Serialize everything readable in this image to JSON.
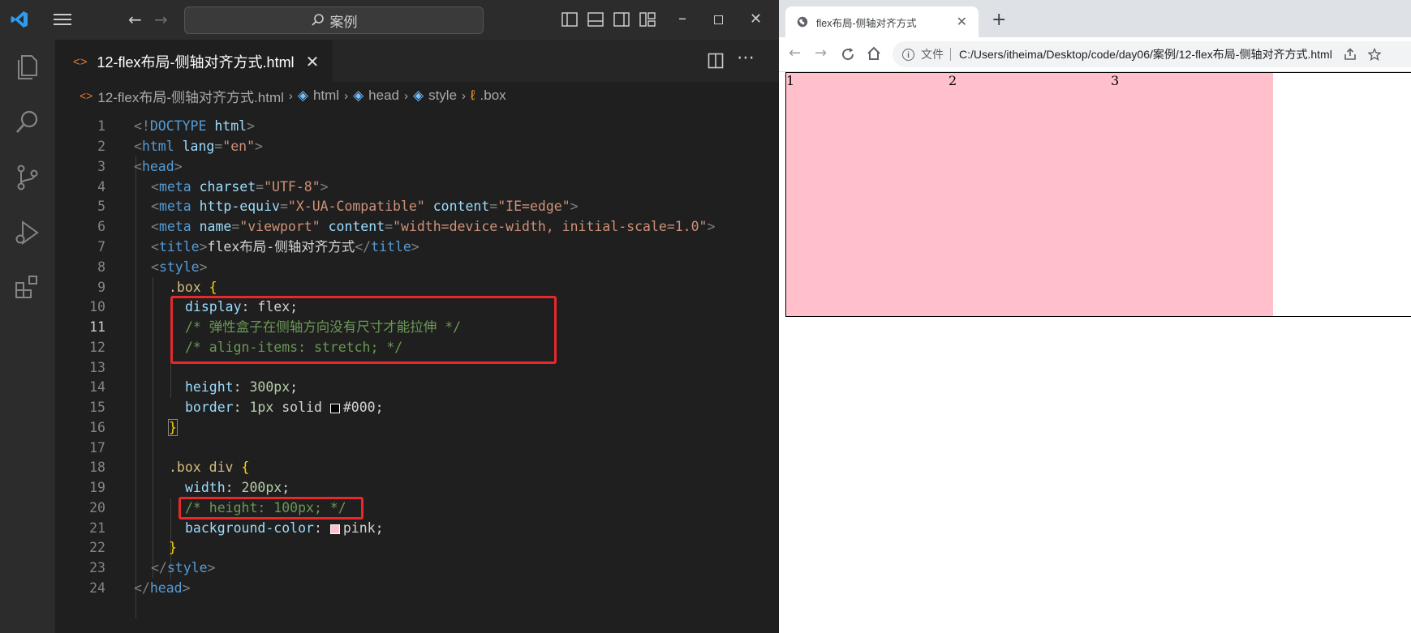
{
  "vscode": {
    "command_center": {
      "text": "案例"
    },
    "tab": {
      "label": "12-flex布局-侧轴对齐方式.html"
    },
    "breadcrumb": {
      "file": "12-flex布局-侧轴对齐方式.html",
      "items": [
        "html",
        "head",
        "style",
        ".box"
      ]
    },
    "code_lines": [
      {
        "n": "1"
      },
      {
        "n": "2"
      },
      {
        "n": "3"
      },
      {
        "n": "4"
      },
      {
        "n": "5"
      },
      {
        "n": "6"
      },
      {
        "n": "7"
      },
      {
        "n": "8"
      },
      {
        "n": "9"
      },
      {
        "n": "10"
      },
      {
        "n": "11"
      },
      {
        "n": "12"
      },
      {
        "n": "13"
      },
      {
        "n": "14"
      },
      {
        "n": "15"
      },
      {
        "n": "16"
      },
      {
        "n": "17"
      },
      {
        "n": "18"
      },
      {
        "n": "19"
      },
      {
        "n": "20"
      },
      {
        "n": "21"
      },
      {
        "n": "22"
      },
      {
        "n": "23"
      },
      {
        "n": "24"
      }
    ],
    "code": {
      "l1": {
        "a": "<!",
        "b": "DOCTYPE",
        "c": " html",
        "d": ">"
      },
      "l2": {
        "a": "<",
        "b": "html",
        "c": " lang",
        "d": "=",
        "e": "\"en\"",
        "f": ">"
      },
      "l3": {
        "a": "<",
        "b": "head",
        "c": ">"
      },
      "l4": {
        "a": "<",
        "b": "meta",
        "c": " charset",
        "d": "=",
        "e": "\"UTF-8\"",
        "f": ">"
      },
      "l5": {
        "a": "<",
        "b": "meta",
        "c": " http-equiv",
        "d": "=",
        "e": "\"X-UA-Compatible\"",
        "f": " content",
        "g": "=",
        "h": "\"IE=edge\"",
        "i": ">"
      },
      "l6": {
        "a": "<",
        "b": "meta",
        "c": " name",
        "d": "=",
        "e": "\"viewport\"",
        "f": " content",
        "g": "=",
        "h": "\"width=device-width, initial-scale=1.0\"",
        "i": ">"
      },
      "l7": {
        "a": "<",
        "b": "title",
        "c": ">",
        "d": "flex布局-侧轴对齐方式",
        "e": "</",
        "f": "title",
        "g": ">"
      },
      "l8": {
        "a": "<",
        "b": "style",
        "c": ">"
      },
      "l9": {
        "a": ".box",
        "b": " {"
      },
      "l10": {
        "a": "display",
        "b": ": ",
        "c": "flex",
        "d": ";"
      },
      "l11": {
        "a": "/* 弹性盒子在侧轴方向没有尺寸才能拉伸 */"
      },
      "l12": {
        "a": "/* align-items: stretch; */"
      },
      "l14": {
        "a": "height",
        "b": ": ",
        "c": "300px",
        "d": ";"
      },
      "l15": {
        "a": "border",
        "b": ": ",
        "c": "1px",
        "d": " solid ",
        "e": "#000",
        "f": ";"
      },
      "l16": {
        "a": "}"
      },
      "l18": {
        "a": ".box div",
        "b": " {"
      },
      "l19": {
        "a": "width",
        "b": ": ",
        "c": "200px",
        "d": ";"
      },
      "l20": {
        "a": "/* height: 100px; */"
      },
      "l21": {
        "a": "background-color",
        "b": ": ",
        "c": "pink",
        "d": ";"
      },
      "l22": {
        "a": "}"
      },
      "l23": {
        "a": "</",
        "b": "style",
        "c": ">"
      },
      "l24": {
        "a": "</",
        "b": "head",
        "c": ">"
      }
    },
    "swatch_colors": {
      "border": "#000000",
      "background": "#ffc0cb"
    },
    "icons": [
      "vscode-logo-icon",
      "menu-icon",
      "back-arrow-icon",
      "forward-arrow-icon",
      "search-icon",
      "explorer-icon",
      "search-icon",
      "source-control-icon",
      "run-debug-icon",
      "extensions-icon",
      "split-editor-icon",
      "more-icon"
    ]
  },
  "chrome": {
    "tab_title": "flex布局-侧轴对齐方式",
    "new_tab": "+",
    "omnibox": {
      "scheme_label": "文件",
      "url": "C:/Users/itheima/Desktop/code/day06/案例/12-flex布局-侧轴对齐方式.html"
    },
    "page": {
      "items": [
        "1",
        "2",
        "3"
      ],
      "item_color": "#ffc0cb"
    },
    "icons": [
      "globe-icon",
      "close-icon",
      "back-icon",
      "forward-icon",
      "reload-icon",
      "home-icon",
      "info-icon",
      "share-icon",
      "bookmark-star-icon"
    ]
  },
  "accent": {
    "annotation_red": "#e8282a"
  }
}
